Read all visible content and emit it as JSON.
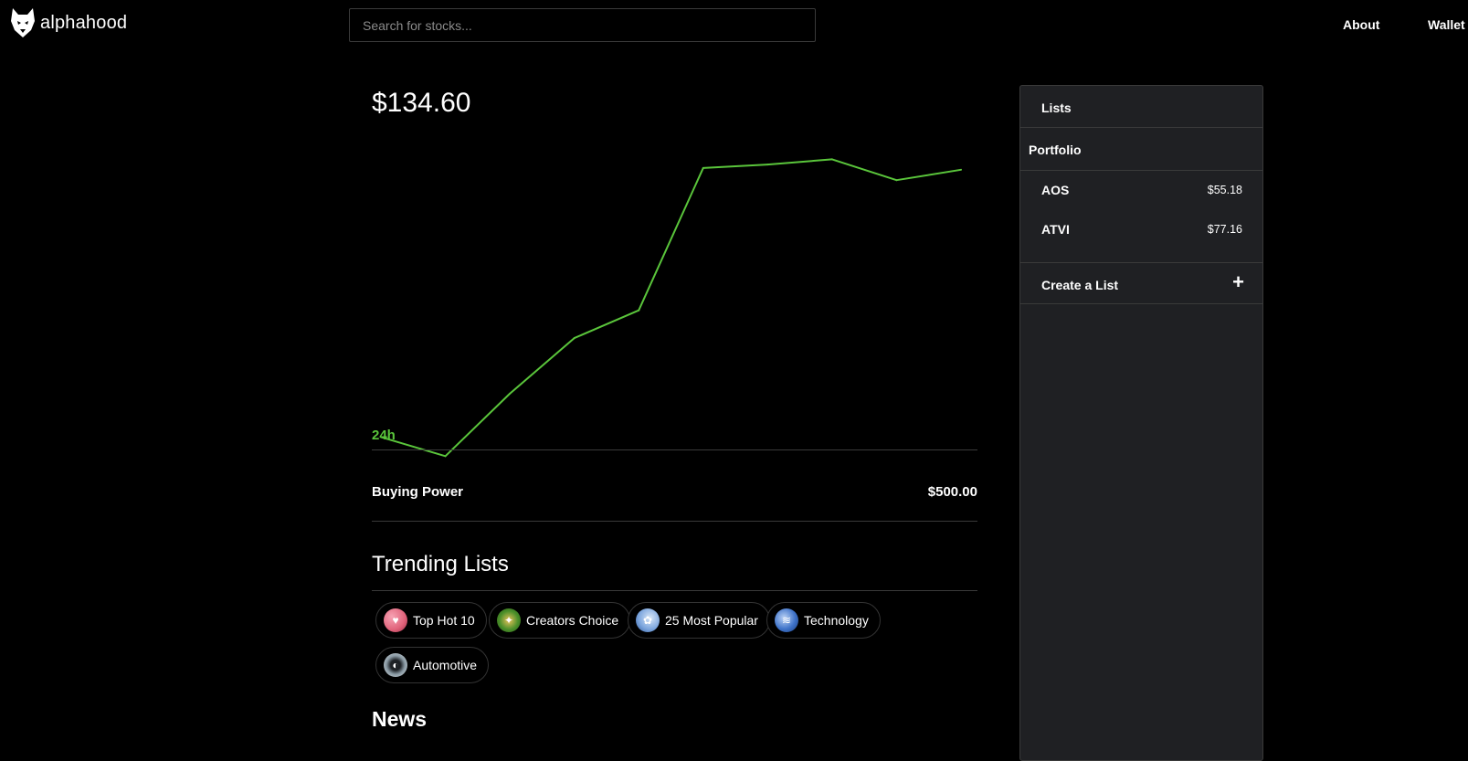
{
  "header": {
    "logo_text": "alphahood",
    "search_placeholder": "Search for stocks...",
    "nav": {
      "about": "About",
      "wallet": "Wallet"
    }
  },
  "portfolio": {
    "value": "$134.60",
    "range": "24h",
    "buying_power_label": "Buying Power",
    "buying_power_value": "$500.00"
  },
  "chart_data": {
    "type": "line",
    "title": "",
    "xlabel": "",
    "ylabel": "",
    "color": "#5ac53b",
    "x": [
      1,
      2,
      3,
      4,
      5,
      6,
      7,
      8,
      9,
      10
    ],
    "values": [
      127.4,
      126.3,
      129.9,
      133.1,
      134.7,
      142.9,
      143.1,
      143.4,
      142.2,
      142.8
    ],
    "ylim": [
      125,
      145
    ],
    "grid": false,
    "legend": "none"
  },
  "trending": {
    "title": "Trending Lists",
    "chips": [
      {
        "label": "Top Hot 10",
        "icon": "fire-avatar-icon",
        "color": "#e0627a"
      },
      {
        "label": "Creators Choice",
        "icon": "star-avatar-icon",
        "color": "#4a8f2a"
      },
      {
        "label": "25 Most Popular",
        "icon": "popular-avatar-icon",
        "color": "#7ea7de"
      },
      {
        "label": "Technology",
        "icon": "tech-avatar-icon",
        "color": "#3f73c9"
      },
      {
        "label": "Automotive",
        "icon": "car-avatar-icon",
        "color": "#8a9aa4"
      }
    ]
  },
  "news": {
    "title": "News"
  },
  "sidebar": {
    "lists_label": "Lists",
    "portfolio_label": "Portfolio",
    "items": [
      {
        "symbol": "AOS",
        "price": "$55.18"
      },
      {
        "symbol": "ATVI",
        "price": "$77.16"
      }
    ],
    "create_label": "Create a List",
    "create_icon": "+"
  }
}
